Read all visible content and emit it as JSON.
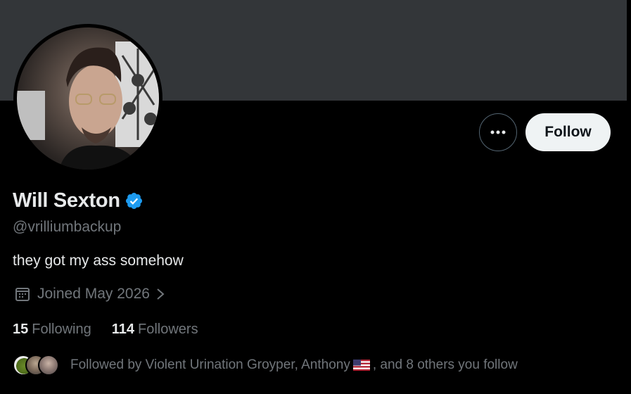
{
  "profile": {
    "name": "Will Sexton",
    "handle": "@vrilliumbackup",
    "bio": "they got my ass somehow",
    "joined": "Joined May 2026",
    "verified": true
  },
  "actions": {
    "more_label": "•••",
    "follow_label": "Follow"
  },
  "stats": {
    "following_count": "15",
    "following_label": "Following",
    "followers_count": "114",
    "followers_label": "Followers"
  },
  "followed_by": {
    "prefix": "Followed by Violent Urination Groyper, Anthony",
    "suffix": ", and 8 others you follow"
  },
  "colors": {
    "banner": "#333639",
    "verified": "#1d9bf0",
    "muted_text": "#71767b",
    "follow_button": "#eff3f4"
  },
  "icons": [
    "more-icon",
    "verified-badge-icon",
    "calendar-icon",
    "chevron-right-icon",
    "us-flag-icon"
  ]
}
